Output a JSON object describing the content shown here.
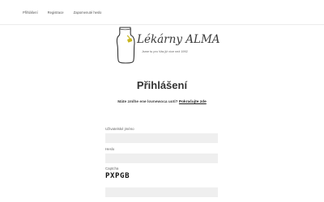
{
  "nav": {
    "items": [
      {
        "label": "Přihlášení"
      },
      {
        "label": "Registrace"
      },
      {
        "label": "Zapomenuté heslo"
      }
    ]
  },
  "logo": {
    "title": "Lékárny ALMA",
    "tagline": "Jsme tu pro Vás již více než 1992"
  },
  "page": {
    "title": "Přihlášení",
    "register_question": "Máte zmlhe ene lovnewoca uoti? ",
    "register_link": "Pokračujte zde"
  },
  "form": {
    "username_label": "Uživatelské jméno",
    "password_label": "Heslo",
    "captcha_label": "Captcha",
    "captcha_text": "PXPGB"
  },
  "colors": {
    "accent": "#c9b61e",
    "input_bg": "#efefef"
  }
}
